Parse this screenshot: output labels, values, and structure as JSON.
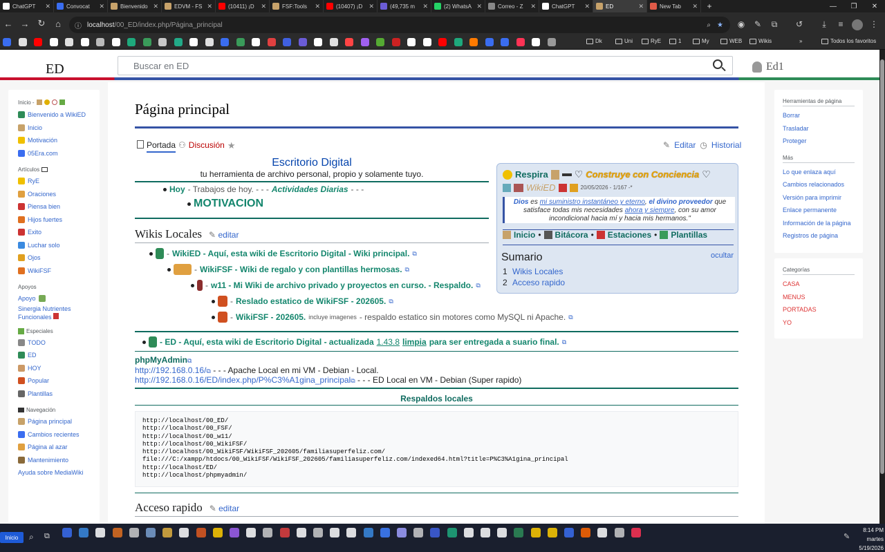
{
  "browser": {
    "tabs": [
      {
        "title": "ChatGPT",
        "color": "#ffffff"
      },
      {
        "title": "Convocat",
        "color": "#3a6df0"
      },
      {
        "title": "Bienvenido",
        "color": "#c7a26a"
      },
      {
        "title": "EDVM - FS",
        "color": "#c7a26a"
      },
      {
        "title": "(10411) ¡D",
        "color": "#ff0000"
      },
      {
        "title": "FSF:Tools",
        "color": "#c7a26a"
      },
      {
        "title": "(10407) ¡D",
        "color": "#ff0000"
      },
      {
        "title": "(49,735 m",
        "color": "#6b5cd6"
      },
      {
        "title": "(2) WhatsA",
        "color": "#25d366"
      },
      {
        "title": "Correo - Z",
        "color": "#888888"
      },
      {
        "title": "ChatGPT",
        "color": "#ffffff"
      },
      {
        "title": "ED",
        "color": "#c7a26a"
      },
      {
        "title": "New Tab",
        "color": "#e05a47"
      }
    ],
    "address": {
      "host": "localhost",
      "path": "/00_ED/index.php/Página_principal"
    },
    "bookmarks": [
      "Dk",
      "Uni",
      "RyE",
      "1",
      "My",
      "WEB",
      "Wikis"
    ],
    "bookmarks_all": "Todos los favoritos",
    "new_tab_label": "+"
  },
  "header": {
    "logo": "ED",
    "search_placeholder": "Buscar en ED",
    "user": "Ed1"
  },
  "left_sidebar": {
    "inicio_heading": "Inicio -",
    "inicio_items": [
      "Bienvenido a WikiED",
      "Inicio",
      "Motivación",
      "05Era.com"
    ],
    "articulos_heading": "Artículos",
    "articulos_items": [
      "RyE",
      "Oraciones",
      "Piensa bien",
      "Hijos fuertes",
      "Exito",
      "Luchar solo",
      "Ojos",
      "WikiFSF"
    ],
    "apoyos_heading": "Apoyos",
    "apoyos_items": [
      "Apoyo",
      "Sinergia Nutrientes",
      "Funcionales"
    ],
    "especiales_heading": "Especiales",
    "especiales_items": [
      "TODO",
      "ED",
      "HOY",
      "Popular",
      "Plantillas"
    ],
    "navegacion_heading": "Navegación",
    "navegacion_items": [
      "Página principal",
      "Cambios recientes",
      "Página al azar",
      "Mantenimiento"
    ],
    "ayuda": "Ayuda sobre MediaWiki"
  },
  "right_sidebar": {
    "tools_heading": "Herramientas de página",
    "tools": [
      "Borrar",
      "Trasladar",
      "Proteger"
    ],
    "mas_heading": "Más",
    "mas": [
      "Lo que enlaza aquí",
      "Cambios relacionados",
      "Versión para imprimir",
      "Enlace permanente",
      "Información de la página",
      "Registros de página"
    ],
    "cat_heading": "Categorías",
    "cats": [
      "CASA",
      "MENUS",
      "PORTADAS",
      "YO"
    ]
  },
  "content": {
    "title": "Página principal",
    "tab_portada": "Portada",
    "tab_discusion": "Discusión",
    "editar": "Editar",
    "historial": "Historial",
    "desk_title": "Escritorio Digital",
    "desk_sub": "tu herramienta de archivo personal, propio y solamente tuyo.",
    "hoy_label": "Hoy",
    "hoy_rest": " - Trabajos de hoy. - - - ",
    "hoy_italic": "Actividades Diarias",
    "hoy_end": " - - -",
    "motivacion": "MOTIVACION",
    "wikis_heading": "Wikis Locales",
    "edit_link": "editar",
    "wiki_items": [
      {
        "dash": "- ",
        "text": "WikiED - Aquí, esta wiki de Escritorio Digital - Wiki principal."
      },
      {
        "dash": "- ",
        "text": "WikiFSF - Wiki de regalo y con plantillas hermosas."
      },
      {
        "dash": "- ",
        "text": "w11 - Mi Wiki de archivo privado y proyectos en curso. - Respaldo."
      },
      {
        "dash": "- ",
        "text": "Reslado estatico de WikiFSF - 202605."
      },
      {
        "dash": "- ",
        "text": "WikiFSF - 202605.",
        "small": " incluye imagenes",
        "tail": " - respaldo estatico sin motores como MySQL ni Apache."
      }
    ],
    "ed_item": {
      "text": "- ED - Aquí, esta wiki de Escritorio Digital - actualizada ",
      "version": "1.43.8",
      "limpia": "limpia",
      "end": " para ser entregada a suario final."
    },
    "phpmyadmin": "phpMyAdmin",
    "url1": "http://192.168.0.16/",
    "url1_desc": " - - - Apache Local en mi VM - Debian - Local.",
    "url2": "http://192.168.0.16/ED/index.php/P%C3%A1gina_principal",
    "url2_desc": " - - - ED Local en VM - Debian (Super rapido)",
    "respaldos_title": "Respaldos locales",
    "code_lines": [
      "http://localhost/00_ED/",
      "http://localhost/00_FSF/",
      "http://localhost/00_w11/",
      "http://localhost/00_WikiFSF/",
      "http://localhost/00_WikiFSF/WikiFSF_202605/familiasuperfeliz.com/",
      "file:///C:/xampp/htdocs/00_WikiFSF/WikiFSF_202605/familiasuperfeliz.com/indexed64.html?title=P%C3%A1gina_principal",
      "http://localhost/ED/",
      "http://localhost/phpmyadmin/"
    ],
    "acceso_heading": "Acceso rapido"
  },
  "infobox": {
    "respira": "Respira",
    "construye": "Construye con Conciencia",
    "wikied": "WikiED",
    "date": "20/05/2026 - 1/167 -*",
    "quote_a": "Dios",
    "quote_b": " es ",
    "quote_c": "mi suministro instantáneo y eterno",
    "quote_d": ", ",
    "quote_e": "el divino proveedor",
    "quote_f": " que satisface todas mis necesidades ",
    "quote_g": "ahora y siempre",
    "quote_h": ", con su amor incondicional hacia mí y hacia mis hermanos.\"",
    "nav": [
      "Inicio",
      "Bitácora",
      "Estaciones",
      "Plantillas"
    ],
    "sumario": "Sumario",
    "ocultar": "ocultar",
    "toc": [
      {
        "n": "1",
        "t": "Wikis Locales"
      },
      {
        "n": "2",
        "t": "Acceso rapido"
      }
    ]
  },
  "taskbar": {
    "start": "Inicio",
    "time": "8:14 PM",
    "day": "martes",
    "date": "5/19/2026"
  }
}
